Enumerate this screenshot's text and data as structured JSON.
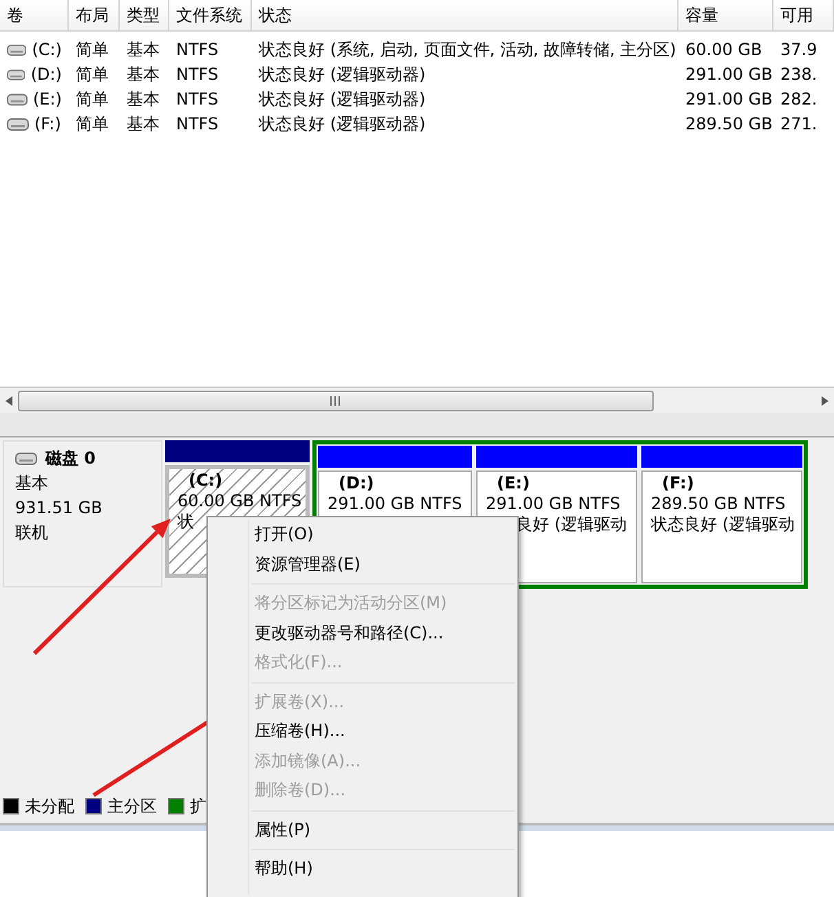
{
  "volume_table": {
    "columns": [
      "卷",
      "布局",
      "类型",
      "文件系统",
      "状态",
      "容量",
      "可用"
    ],
    "rows": [
      [
        "(C:)",
        "简单",
        "基本",
        "NTFS",
        "状态良好 (系统, 启动, 页面文件, 活动, 故障转储, 主分区)",
        "60.00 GB",
        "37.9"
      ],
      [
        "(D:)",
        "简单",
        "基本",
        "NTFS",
        "状态良好 (逻辑驱动器)",
        "291.00 GB",
        "238."
      ],
      [
        "(E:)",
        "简单",
        "基本",
        "NTFS",
        "状态良好 (逻辑驱动器)",
        "291.00 GB",
        "282."
      ],
      [
        "(F:)",
        "简单",
        "基本",
        "NTFS",
        "状态良好 (逻辑驱动器)",
        "289.50 GB",
        "271."
      ]
    ]
  },
  "disk": {
    "name": "磁盘 0",
    "type": "基本",
    "size": "931.51 GB",
    "status": "联机"
  },
  "partitions": [
    {
      "label": "(C:)",
      "size_fs": "60.00 GB NTFS",
      "status": "状",
      "kind": "primary",
      "selected": true
    },
    {
      "label": "(D:)",
      "size_fs": "291.00 GB NTFS",
      "kind": "logical",
      "selected": false
    },
    {
      "label": "(E:)",
      "size_fs": "291.00 GB NTFS",
      "status": "良好 (逻辑驱动",
      "kind": "logical",
      "selected": false
    },
    {
      "label": "(F:)",
      "size_fs": "289.50 GB NTFS",
      "status": "状态良好 (逻辑驱动",
      "kind": "logical",
      "selected": false
    }
  ],
  "legend": [
    {
      "label": "未分配",
      "color": "#000000"
    },
    {
      "label": "主分区",
      "color": "#000080"
    },
    {
      "label": "扩",
      "color": "#008000"
    }
  ],
  "context_menu": [
    {
      "kind": "item",
      "label": "打开(O)",
      "disabled": false
    },
    {
      "kind": "item",
      "label": "资源管理器(E)",
      "disabled": false
    },
    {
      "kind": "separator"
    },
    {
      "kind": "item",
      "label": "将分区标记为活动分区(M)",
      "disabled": true
    },
    {
      "kind": "item",
      "label": "更改驱动器号和路径(C)...",
      "disabled": false
    },
    {
      "kind": "item",
      "label": "格式化(F)...",
      "disabled": true
    },
    {
      "kind": "separator"
    },
    {
      "kind": "item",
      "label": "扩展卷(X)...",
      "disabled": true
    },
    {
      "kind": "item",
      "label": "压缩卷(H)...",
      "disabled": false
    },
    {
      "kind": "item",
      "label": "添加镜像(A)...",
      "disabled": true
    },
    {
      "kind": "item",
      "label": "删除卷(D)...",
      "disabled": true
    },
    {
      "kind": "separator"
    },
    {
      "kind": "item",
      "label": "属性(P)",
      "disabled": false
    },
    {
      "kind": "separator"
    },
    {
      "kind": "item",
      "label": "帮助(H)",
      "disabled": false
    }
  ]
}
